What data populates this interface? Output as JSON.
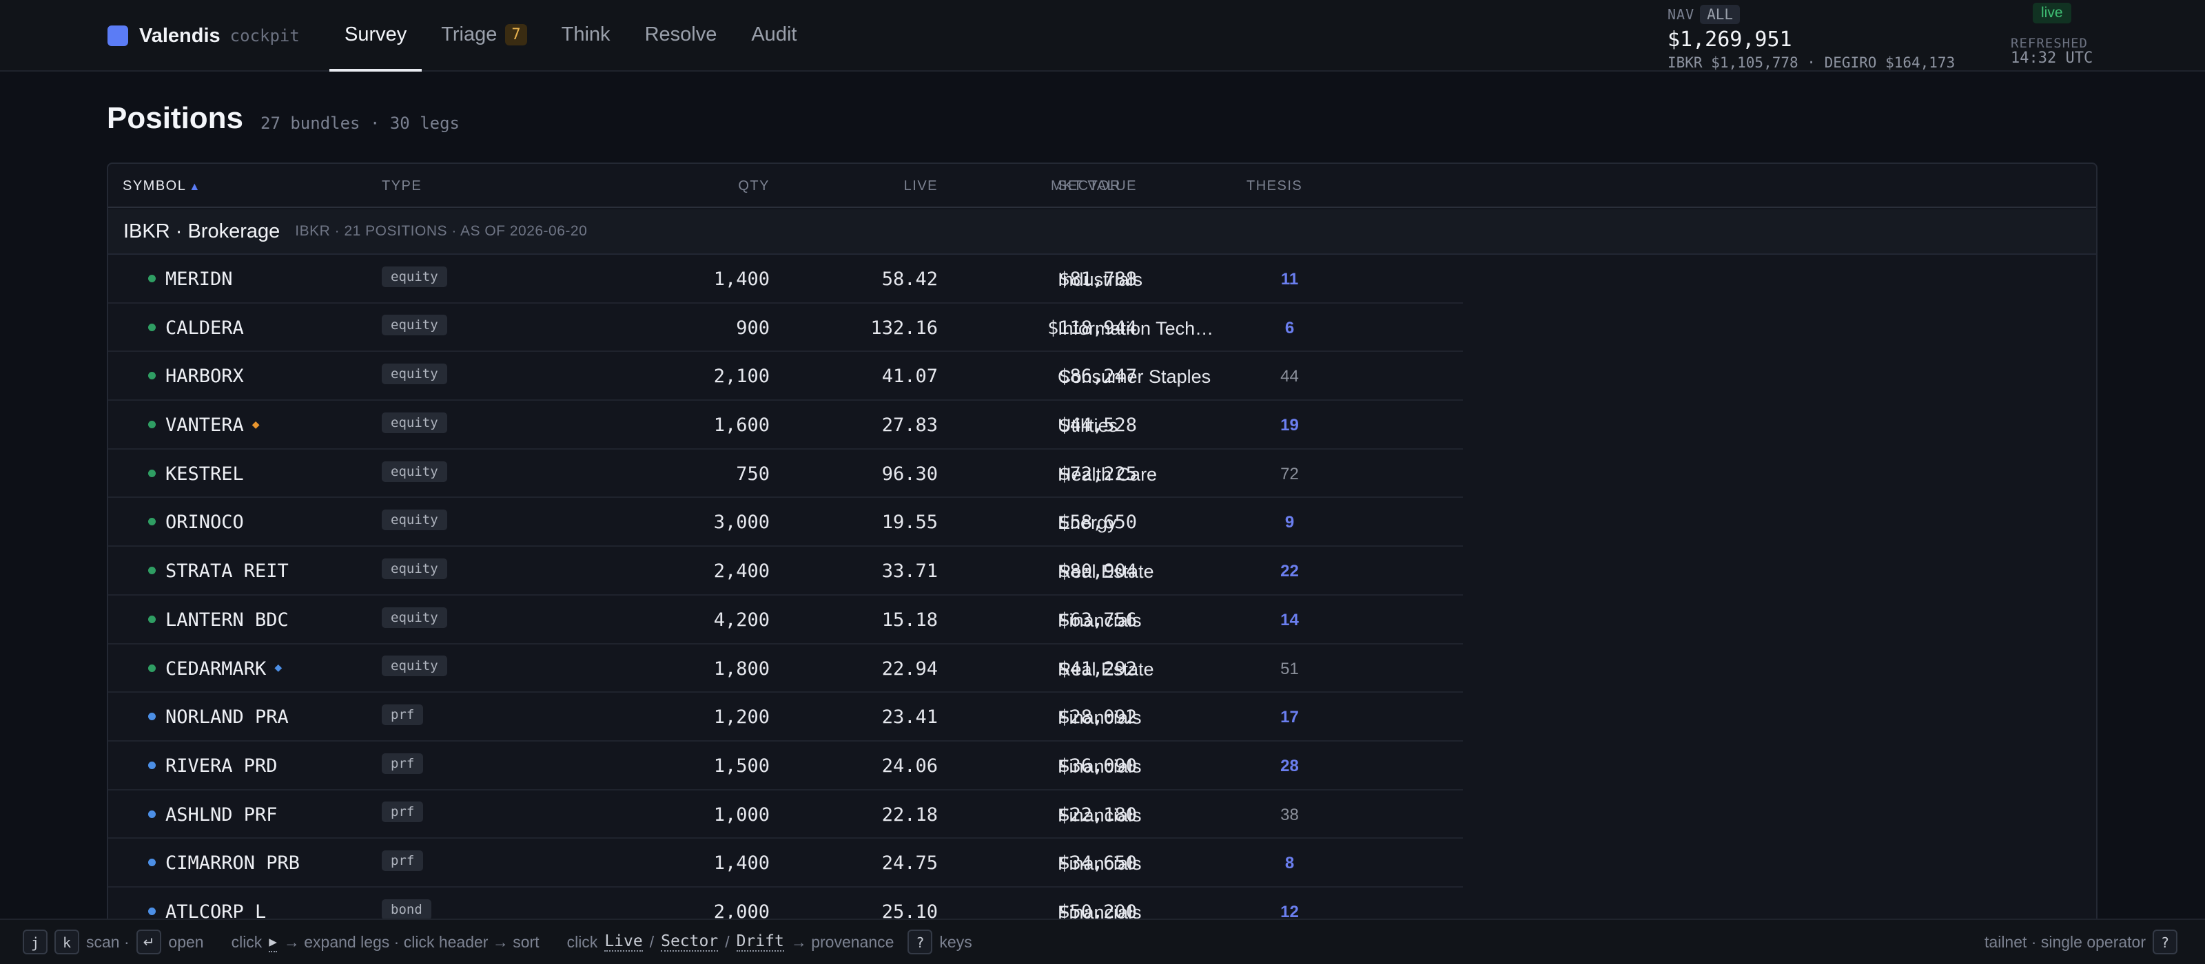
{
  "app": {
    "name": "Valendis",
    "subtitle": "cockpit",
    "accent": "#5b7cf5"
  },
  "nav": {
    "tabs": [
      {
        "label": "Survey",
        "active": true
      },
      {
        "label": "Triage",
        "count": "7"
      },
      {
        "label": "Think"
      },
      {
        "label": "Resolve"
      },
      {
        "label": "Audit"
      }
    ]
  },
  "nav_summary": {
    "label": "NAV",
    "scope": "ALL",
    "total": "$1,269,951",
    "breakdown": "IBKR $1,105,778 · DEGIRO $164,173",
    "status": "live",
    "refreshed_label": "REFRESHED",
    "refreshed_time": "14:32 UTC"
  },
  "page": {
    "title": "Positions",
    "subtitle": "27 bundles · 30 legs"
  },
  "table": {
    "columns": {
      "symbol": "SYMBOL",
      "type": "TYPE",
      "qty": "QTY",
      "live": "LIVE",
      "mkt_value": "MKT VALUE",
      "sector": "SECTOR",
      "thesis": "THESIS"
    },
    "sort_indicator": "▲",
    "group": {
      "name": "IBKR · Brokerage",
      "meta": "IBKR · 21 POSITIONS · AS OF 2026-06-20"
    },
    "rows": [
      {
        "symbol": "MERIDN",
        "type": "equity",
        "qty": "1,400",
        "live": "58.42",
        "mkt": "$81,788",
        "sector": "Industrials",
        "thesis": "11",
        "dot": "green",
        "thesis_link": true
      },
      {
        "symbol": "CALDERA",
        "type": "equity",
        "qty": "900",
        "live": "132.16",
        "mkt": "$118,944",
        "sector": "Information Tech…",
        "thesis": "6",
        "dot": "green",
        "thesis_link": true
      },
      {
        "symbol": "HARBORX",
        "type": "equity",
        "qty": "2,100",
        "live": "41.07",
        "mkt": "$86,247",
        "sector": "Consumer Staples",
        "thesis": "44",
        "dot": "green",
        "thesis_link": false
      },
      {
        "symbol": "VANTERA",
        "type": "equity",
        "qty": "1,600",
        "live": "27.83",
        "mkt": "$44,528",
        "sector": "Utilities",
        "thesis": "19",
        "dot": "green",
        "thesis_link": true,
        "flag": "orange"
      },
      {
        "symbol": "KESTREL",
        "type": "equity",
        "qty": "750",
        "live": "96.30",
        "mkt": "$72,225",
        "sector": "Health Care",
        "thesis": "72",
        "dot": "green",
        "thesis_link": false
      },
      {
        "symbol": "ORINOCO",
        "type": "equity",
        "qty": "3,000",
        "live": "19.55",
        "mkt": "$58,650",
        "sector": "Energy",
        "thesis": "9",
        "dot": "green",
        "thesis_link": true
      },
      {
        "symbol": "STRATA REIT",
        "type": "equity",
        "qty": "2,400",
        "live": "33.71",
        "mkt": "$80,904",
        "sector": "Real Estate",
        "thesis": "22",
        "dot": "green",
        "thesis_link": true
      },
      {
        "symbol": "LANTERN BDC",
        "type": "equity",
        "qty": "4,200",
        "live": "15.18",
        "mkt": "$63,756",
        "sector": "Financials",
        "thesis": "14",
        "dot": "green",
        "thesis_link": true
      },
      {
        "symbol": "CEDARMARK",
        "type": "equity",
        "qty": "1,800",
        "live": "22.94",
        "mkt": "$41,292",
        "sector": "Real Estate",
        "thesis": "51",
        "dot": "green",
        "thesis_link": false,
        "flag": "blue"
      },
      {
        "symbol": "NORLAND PRA",
        "type": "prf",
        "qty": "1,200",
        "live": "23.41",
        "mkt": "$28,092",
        "sector": "Financials",
        "thesis": "17",
        "dot": "blue",
        "thesis_link": true
      },
      {
        "symbol": "RIVERA PRD",
        "type": "prf",
        "qty": "1,500",
        "live": "24.06",
        "mkt": "$36,090",
        "sector": "Financials",
        "thesis": "28",
        "dot": "blue",
        "thesis_link": true
      },
      {
        "symbol": "ASHLND PRF",
        "type": "prf",
        "qty": "1,000",
        "live": "22.18",
        "mkt": "$22,180",
        "sector": "Financials",
        "thesis": "38",
        "dot": "blue",
        "thesis_link": false
      },
      {
        "symbol": "CIMARRON PRB",
        "type": "prf",
        "qty": "1,400",
        "live": "24.75",
        "mkt": "$34,650",
        "sector": "Financials",
        "thesis": "8",
        "dot": "blue",
        "thesis_link": true
      },
      {
        "symbol": "ATLCORP L",
        "type": "bond",
        "qty": "2,000",
        "live": "25.10",
        "mkt": "$50,200",
        "sector": "Financials",
        "thesis": "12",
        "dot": "blue",
        "thesis_link": true
      }
    ]
  },
  "status_colors": {
    "green": "#2f9e63",
    "blue": "#4c8fe6",
    "orange": "#e8952e"
  },
  "bottom_bar": {
    "key_j": "j",
    "key_k": "k",
    "scan_text": "scan ·",
    "key_enter": "↵",
    "open_text": "open",
    "expand_text_a": "click",
    "expand_glyph": "▸",
    "expand_text_b": "→ expand legs · click header → sort",
    "prov_text_a": "click",
    "prov_live": "Live",
    "prov_sep1": "/",
    "prov_sector": "Sector",
    "prov_sep2": "/",
    "prov_drift": "Drift",
    "prov_text_b": "→ provenance",
    "key_help": "?",
    "keys_text": "keys",
    "right_text": "tailnet · single operator",
    "right_key": "?"
  }
}
